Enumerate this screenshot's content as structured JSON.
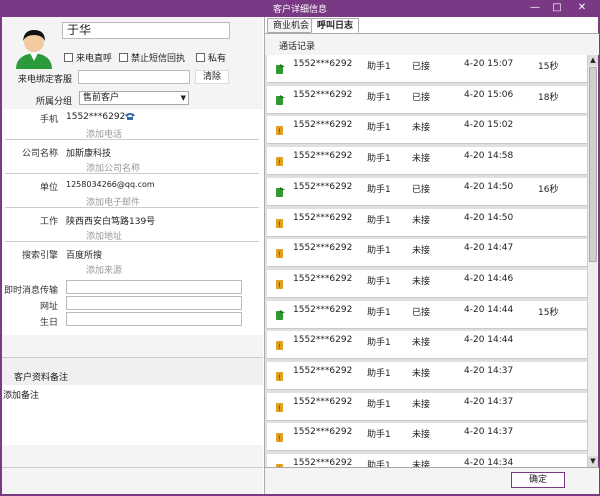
{
  "window": {
    "title": "客户详细信息",
    "min": "—",
    "max": "□",
    "close": "✕"
  },
  "customer": {
    "name": "于华",
    "options": [
      "来电直呼",
      "禁止短信回执",
      "私有"
    ],
    "bind_agent_label": "来电绑定客服",
    "clear_label": "清除",
    "group_label": "所属分组",
    "group_value": "售前客户",
    "fields": [
      {
        "label": "手机",
        "value": "1552***6292",
        "add": "添加电话"
      },
      {
        "label": "公司名称",
        "value": "加斯康科技",
        "add": "添加公司名称"
      },
      {
        "label": "单位",
        "value": "1258034266@qq.com",
        "add": "添加电子邮件"
      },
      {
        "label": "工作",
        "value": "陕西西安白笃路139号",
        "add": "添加地址"
      },
      {
        "label": "搜索引擎",
        "value": "百度所搜",
        "add": "添加来源"
      }
    ],
    "im_label": "即时消息传输",
    "url_label": "网址",
    "birthday_label": "生日",
    "notes_title": "客户资料备注",
    "notes_add": "添加备注"
  },
  "tabs": [
    {
      "label": "商业机会"
    },
    {
      "label": "呼叫日志"
    }
  ],
  "records_title": "通话记录",
  "records": [
    {
      "type": "answered",
      "phone": "1552***6292",
      "agent": "助手1",
      "status": "已接",
      "time": "4-20 15:07",
      "duration": "15秒"
    },
    {
      "type": "answered",
      "phone": "1552***6292",
      "agent": "助手1",
      "status": "已接",
      "time": "4-20 15:06",
      "duration": "18秒"
    },
    {
      "type": "missed",
      "phone": "1552***6292",
      "agent": "助手1",
      "status": "未接",
      "time": "4-20 15:02",
      "duration": ""
    },
    {
      "type": "missed",
      "phone": "1552***6292",
      "agent": "助手1",
      "status": "未接",
      "time": "4-20 14:58",
      "duration": ""
    },
    {
      "type": "answered",
      "phone": "1552***6292",
      "agent": "助手1",
      "status": "已接",
      "time": "4-20 14:50",
      "duration": "16秒"
    },
    {
      "type": "missed",
      "phone": "1552***6292",
      "agent": "助手1",
      "status": "未接",
      "time": "4-20 14:50",
      "duration": ""
    },
    {
      "type": "missed",
      "phone": "1552***6292",
      "agent": "助手1",
      "status": "未接",
      "time": "4-20 14:47",
      "duration": ""
    },
    {
      "type": "missed",
      "phone": "1552***6292",
      "agent": "助手1",
      "status": "未接",
      "time": "4-20 14:46",
      "duration": ""
    },
    {
      "type": "answered",
      "phone": "1552***6292",
      "agent": "助手1",
      "status": "已接",
      "time": "4-20 14:44",
      "duration": "15秒"
    },
    {
      "type": "missed",
      "phone": "1552***6292",
      "agent": "助手1",
      "status": "未接",
      "time": "4-20 14:44",
      "duration": ""
    },
    {
      "type": "missed",
      "phone": "1552***6292",
      "agent": "助手1",
      "status": "未接",
      "time": "4-20 14:37",
      "duration": ""
    },
    {
      "type": "missed",
      "phone": "1552***6292",
      "agent": "助手1",
      "status": "未接",
      "time": "4-20 14:37",
      "duration": ""
    },
    {
      "type": "missed",
      "phone": "1552***6292",
      "agent": "助手1",
      "status": "未接",
      "time": "4-20 14:37",
      "duration": ""
    },
    {
      "type": "missed",
      "phone": "1552***6292",
      "agent": "助手1",
      "status": "未接",
      "time": "4-20 14:34",
      "duration": ""
    }
  ],
  "ok_label": "确定",
  "colors": {
    "titlebar": "#7a3984",
    "answered_icon": "#2e9a2e",
    "missed_icon": "#e0a020"
  }
}
